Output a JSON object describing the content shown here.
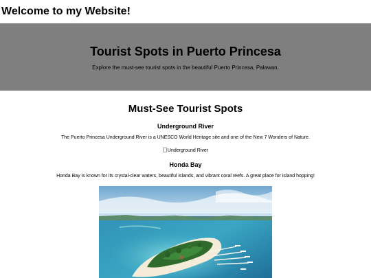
{
  "site": {
    "heading": "Welcome to my Website!"
  },
  "hero": {
    "title": "Tourist Spots in Puerto Princesa",
    "subtitle": "Explore the must-see tourist spots in the beautiful Puerto Princesa, Palawan."
  },
  "spots": {
    "title": "Must-See Tourist Spots",
    "items": [
      {
        "name": "Underground River",
        "description": "The Puerto Princesa Underground River is a UNESCO World Heritage site and one of the New 7 Wonders of Nature.",
        "image_alt": "Underground River"
      },
      {
        "name": "Honda Bay",
        "description": "Honda Bay is known for its crystal-clear waters, beautiful islands, and vibrant coral reefs. A great place for island hopping!"
      }
    ]
  }
}
